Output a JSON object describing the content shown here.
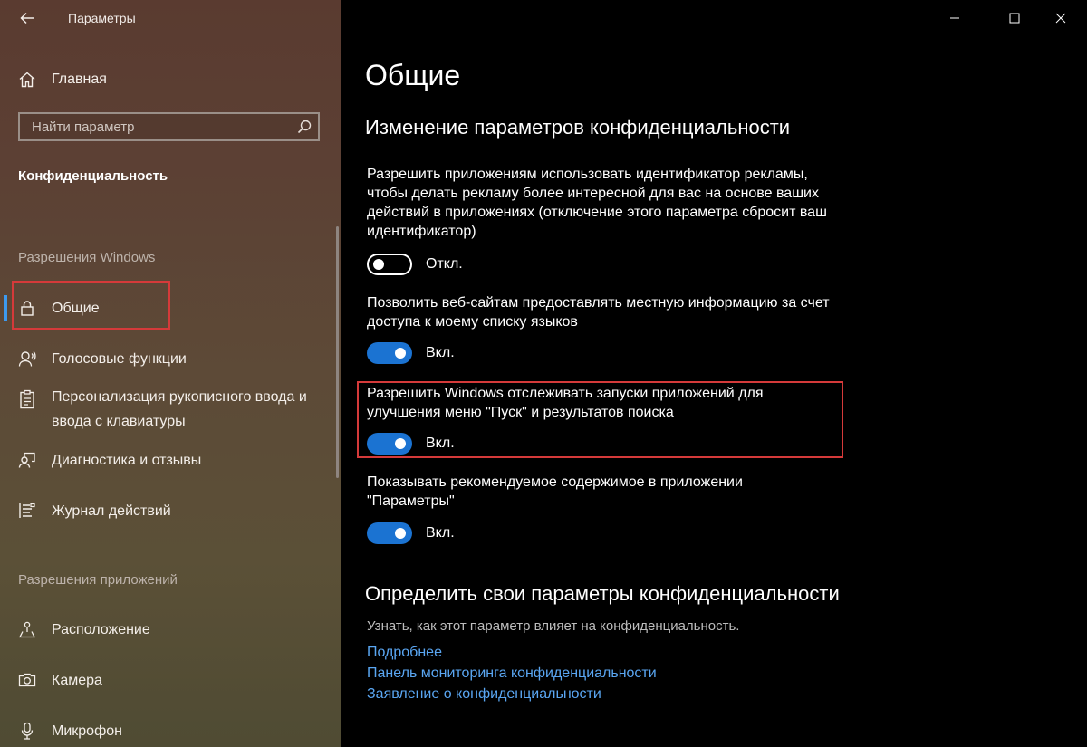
{
  "window": {
    "title": "Параметры",
    "controls": [
      "minimize-icon",
      "maximize-icon",
      "close-icon"
    ]
  },
  "sidebar": {
    "home": {
      "label": "Главная",
      "icon": "home-icon"
    },
    "search": {
      "placeholder": "Найти параметр",
      "value": "",
      "icon": "search-icon"
    },
    "section_title": "Конфиденциальность",
    "groups": [
      {
        "label": "Разрешения Windows",
        "items": [
          {
            "label": "Общие",
            "icon": "lock-icon",
            "active": true
          },
          {
            "label": "Голосовые функции",
            "icon": "voice-icon"
          },
          {
            "label": "Персонализация рукописного ввода и ввода с клавиатуры",
            "icon": "clipboard-icon"
          },
          {
            "label": "Диагностика и отзывы",
            "icon": "feedback-icon"
          },
          {
            "label": "Журнал действий",
            "icon": "timeline-icon"
          }
        ]
      },
      {
        "label": "Разрешения приложений",
        "items": [
          {
            "label": "Расположение",
            "icon": "location-icon"
          },
          {
            "label": "Камера",
            "icon": "camera-icon"
          },
          {
            "label": "Микрофон",
            "icon": "microphone-icon"
          }
        ]
      }
    ]
  },
  "main": {
    "title": "Общие",
    "privacy_heading": "Изменение параметров конфиденциальности",
    "settings": [
      {
        "description": "Разрешить приложениям использовать идентификатор рекламы, чтобы делать рекламу более интересной для вас на основе ваших действий в приложениях (отключение этого параметра сбросит ваш идентификатор)",
        "state": "off",
        "state_label": "Откл."
      },
      {
        "description": "Позволить веб-сайтам предоставлять местную информацию за счет доступа к моему списку языков",
        "state": "on",
        "state_label": "Вкл."
      },
      {
        "description": "Разрешить Windows отслеживать запуски приложений для улучшения меню \"Пуск\" и результатов поиска",
        "state": "on",
        "state_label": "Вкл.",
        "highlighted": true
      },
      {
        "description": "Показывать рекомендуемое содержимое в приложении \"Параметры\"",
        "state": "on",
        "state_label": "Вкл."
      }
    ],
    "know_heading": "Определить свои параметры конфиденциальности",
    "know_text": "Узнать, как этот параметр влияет на конфиденциальность.",
    "links": [
      "Подробнее",
      "Панель мониторинга конфиденциальности",
      "Заявление о конфиденциальности"
    ]
  },
  "colors": {
    "accent": "#1b73d2",
    "link": "#5aa6f2",
    "highlight_frame": "#d53a3a",
    "active_indicator": "#3d9af0"
  }
}
